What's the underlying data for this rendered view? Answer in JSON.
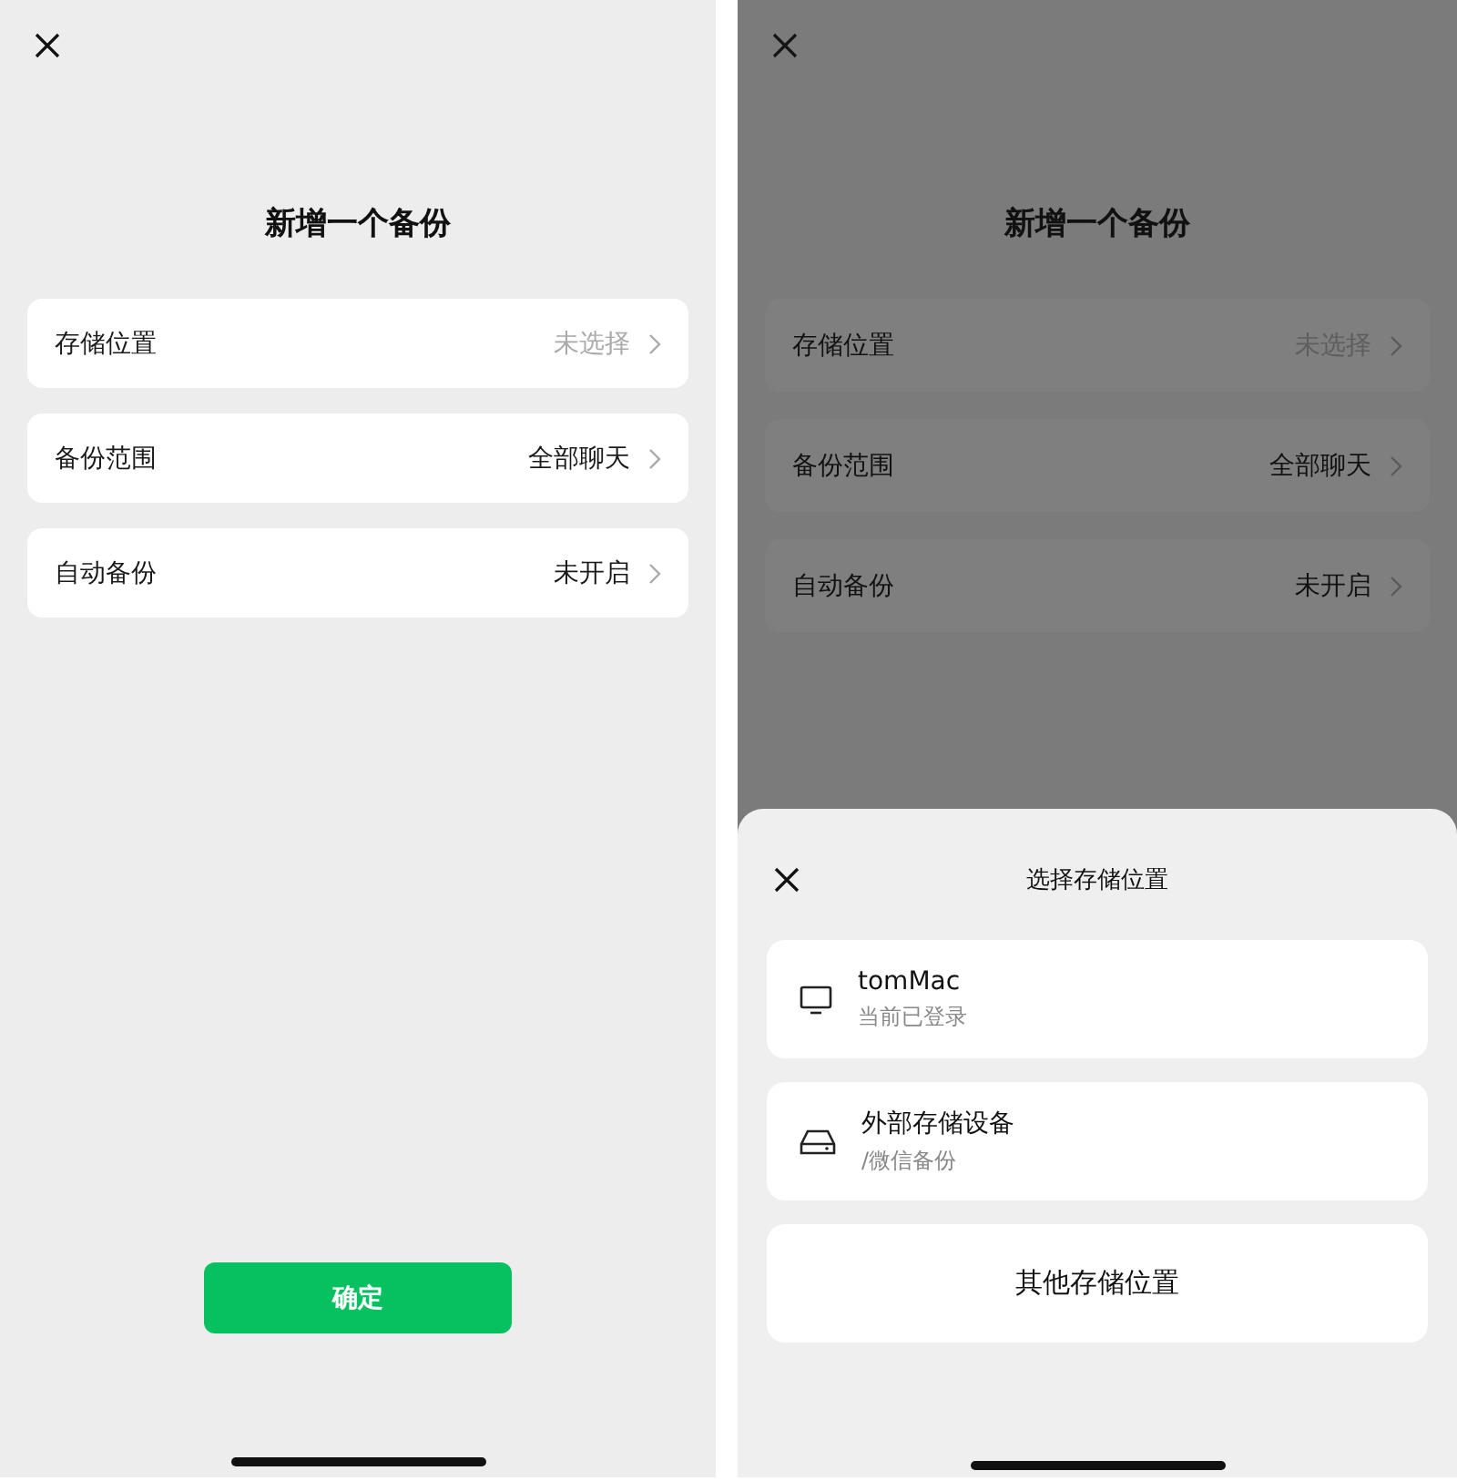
{
  "screens": [
    {
      "title": "新增一个备份",
      "dimmed": false,
      "rows": [
        {
          "label": "存储位置",
          "value": "未选择",
          "muted": true
        },
        {
          "label": "备份范围",
          "value": "全部聊天",
          "muted": false
        },
        {
          "label": "自动备份",
          "value": "未开启",
          "muted": false
        }
      ],
      "confirm_button": "确定"
    },
    {
      "title": "新增一个备份",
      "dimmed": true,
      "rows": [
        {
          "label": "存储位置",
          "value": "未选择",
          "muted": true
        },
        {
          "label": "备份范围",
          "value": "全部聊天",
          "muted": false
        },
        {
          "label": "自动备份",
          "value": "未开启",
          "muted": false
        }
      ],
      "sheet": {
        "title": "选择存储位置",
        "options": [
          {
            "kind": "computer",
            "name": "tomMac",
            "detail": "当前已登录"
          },
          {
            "kind": "drive",
            "name": "外部存储设备",
            "detail": "/微信备份"
          },
          {
            "kind": "plain",
            "name": "其他存储位置"
          }
        ]
      }
    }
  ]
}
